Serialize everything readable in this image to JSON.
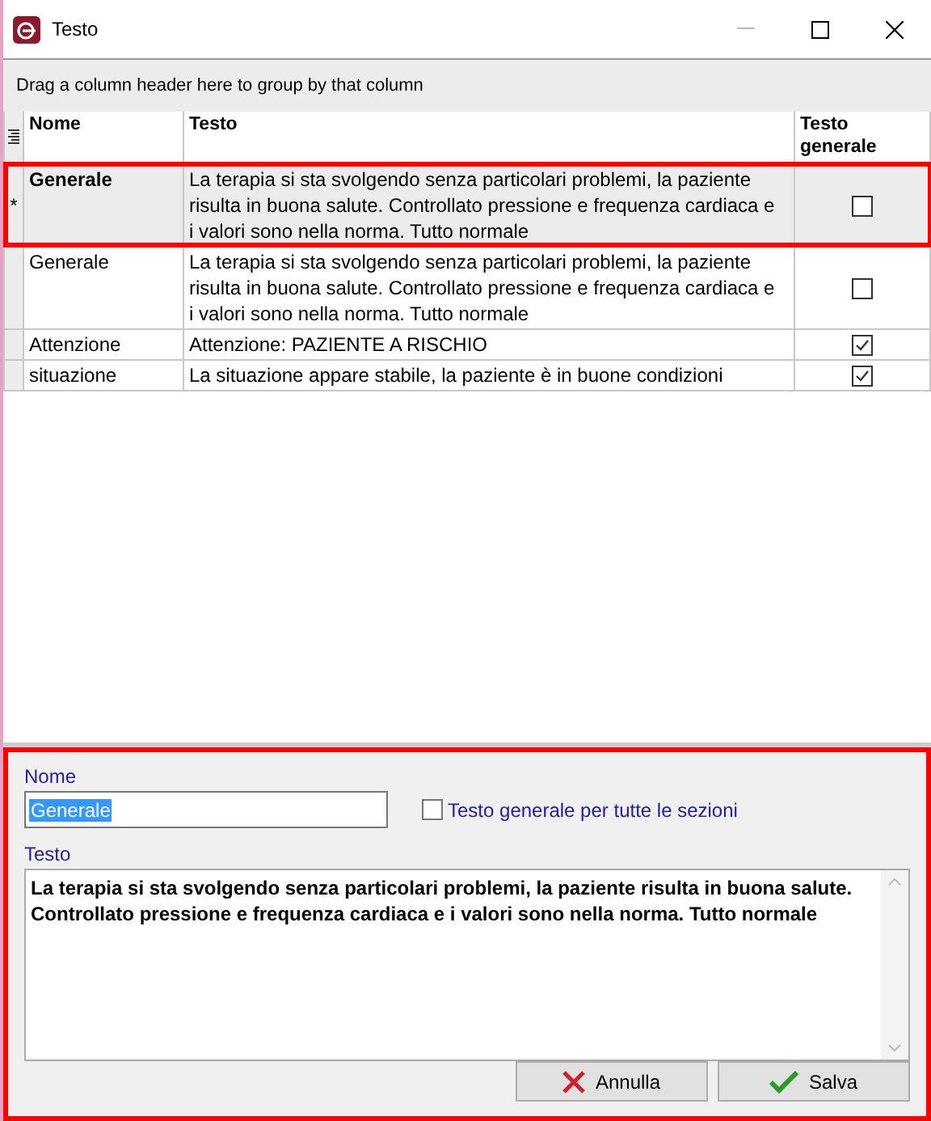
{
  "window": {
    "title": "Testo"
  },
  "group_hint": "Drag a column header here to group by that column",
  "table": {
    "columns": [
      "Nome",
      "Testo",
      "Testo generale"
    ],
    "rows": [
      {
        "indicator": "*",
        "name": "Generale",
        "text": "La terapia si sta svolgendo senza particolari problemi, la paziente risulta in buona salute. Controllato pressione e frequenza cardiaca e i valori sono nella norma. Tutto normale",
        "general": false,
        "selected": true
      },
      {
        "name": "Generale",
        "text": "La terapia si sta svolgendo senza particolari problemi, la paziente risulta in buona salute. Controllato pressione e frequenza cardiaca e i valori sono nella norma. Tutto normale",
        "general": false,
        "selected": false
      },
      {
        "name": "Attenzione",
        "text": "Attenzione: PAZIENTE A RISCHIO",
        "general": true,
        "selected": false
      },
      {
        "name": "situazione",
        "text": "La situazione appare stabile, la paziente è in buone condizioni",
        "general": true,
        "selected": false
      }
    ]
  },
  "editor": {
    "name_label": "Nome",
    "name_value": "Generale",
    "general_label": "Testo generale per tutte le sezioni",
    "general_checked": false,
    "text_label": "Testo",
    "text_value": "La terapia si sta svolgendo senza particolari problemi, la paziente risulta in buona salute. Controllato pressione e frequenza cardiaca e i valori sono nella norma. Tutto normale"
  },
  "buttons": [
    {
      "kind": "cancel",
      "label": "Annulla"
    },
    {
      "kind": "save",
      "label": "Salva"
    }
  ]
}
